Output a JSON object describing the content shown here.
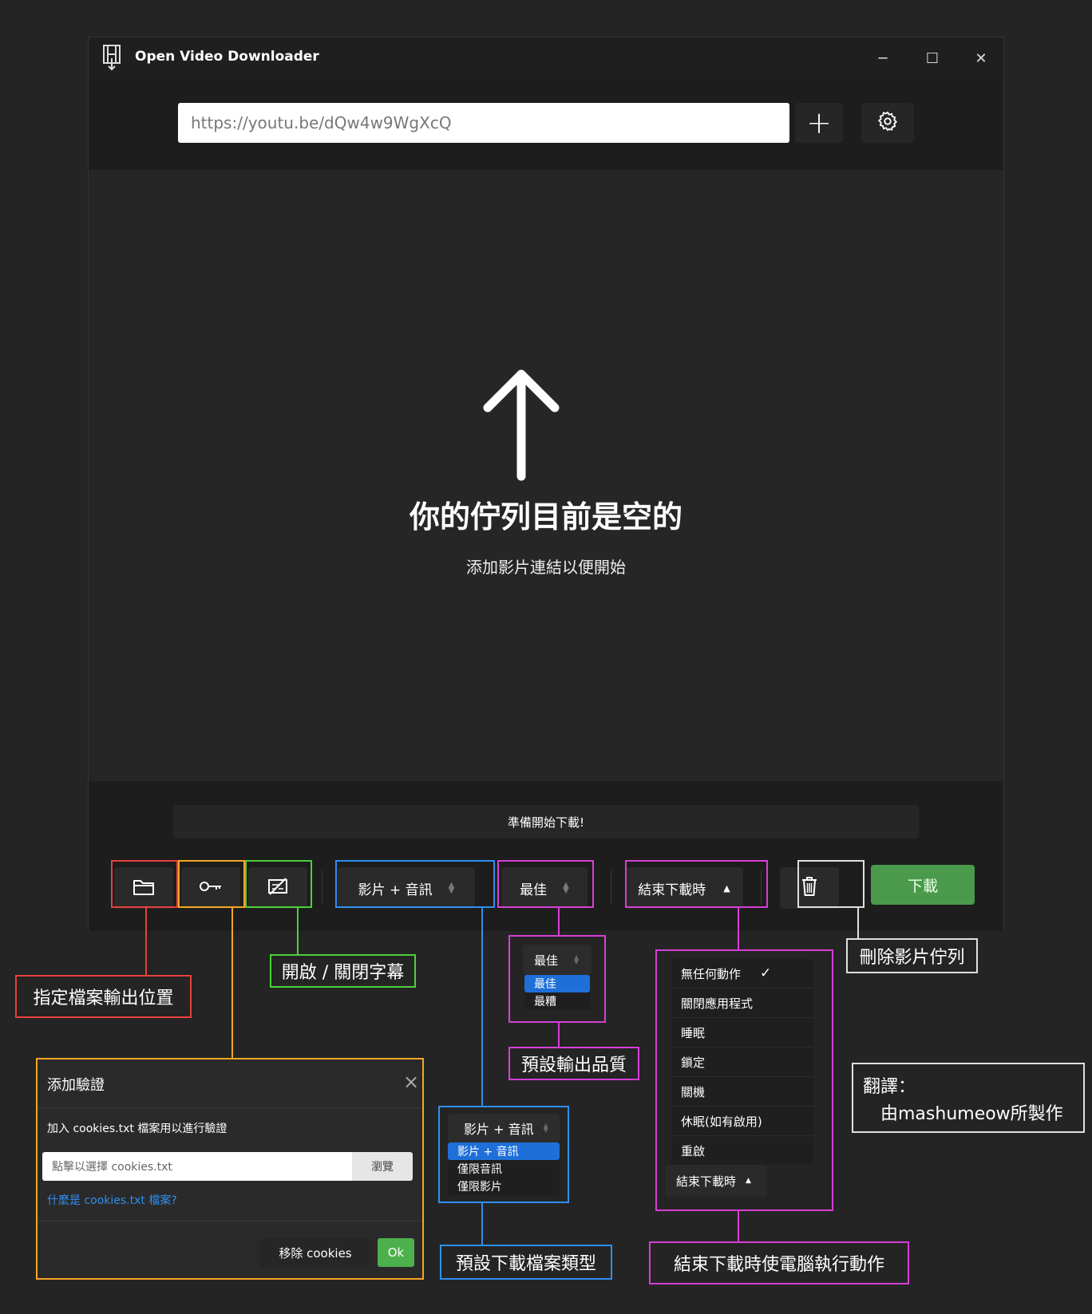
{
  "window": {
    "title": "Open Video Downloader",
    "controls": {
      "minimize": "─",
      "maximize": "☐",
      "close": "✕"
    }
  },
  "topbar": {
    "url_value": "https://youtu.be/dQw4w9WgXcQ",
    "add_label": "+"
  },
  "queue": {
    "empty_title": "你的佇列目前是空的",
    "empty_subtitle": "添加影片連結以便開始"
  },
  "status": {
    "text": "準備開始下載!"
  },
  "toolbar": {
    "type_select": "影片 + 音訊",
    "quality_select": "最佳",
    "after_select": "結束下載時",
    "after_caret": "▲",
    "download_label": "下載"
  },
  "annotations": {
    "output_location": "指定檔案輸出位置",
    "subtitles": "開啟 / 關閉字幕",
    "default_quality": "預設輸出品質",
    "default_type": "預設下載檔案類型",
    "after_action": "結束下載時使電腦執行動作",
    "clear_queue": "刪除影片佇列",
    "translation_line1": "翻譯：",
    "translation_line2": "由mashumeow所製作"
  },
  "quality_popup": {
    "selected": "最佳",
    "options": [
      "最佳",
      "最糟"
    ]
  },
  "type_popup": {
    "selected": "影片 + 音訊",
    "options": [
      "影片 + 音訊",
      "僅限音訊",
      "僅限影片"
    ]
  },
  "after_popup": {
    "options": [
      "無任何動作",
      "關閉應用程式",
      "睡眠",
      "鎖定",
      "關機",
      "休眠(如有啟用)",
      "重啟"
    ],
    "checkmark": "✓",
    "button_label": "結束下載時",
    "button_caret": "▲"
  },
  "auth_dialog": {
    "title": "添加驗證",
    "close": "×",
    "description": "加入 cookies.txt 檔案用以進行驗證",
    "file_placeholder": "點擊以選擇 cookies.txt",
    "browse_label": "瀏覽",
    "help_link": "什麼是 cookies.txt 檔案?",
    "remove_label": "移除 cookies",
    "ok_label": "Ok"
  },
  "colors": {
    "red": "#e8413c",
    "orange": "#f5a623",
    "green": "#4cd13a",
    "blue": "#2f8ff0",
    "magenta": "#d63fd6",
    "white": "#e0e0e0",
    "download_green": "#4b9a4b",
    "highlight_blue": "#1f6fd9"
  },
  "icons": [
    "app-logo-icon",
    "settings-gear-icon",
    "up-arrow-icon",
    "folder-icon",
    "key-icon",
    "subtitles-off-icon",
    "trash-icon"
  ]
}
